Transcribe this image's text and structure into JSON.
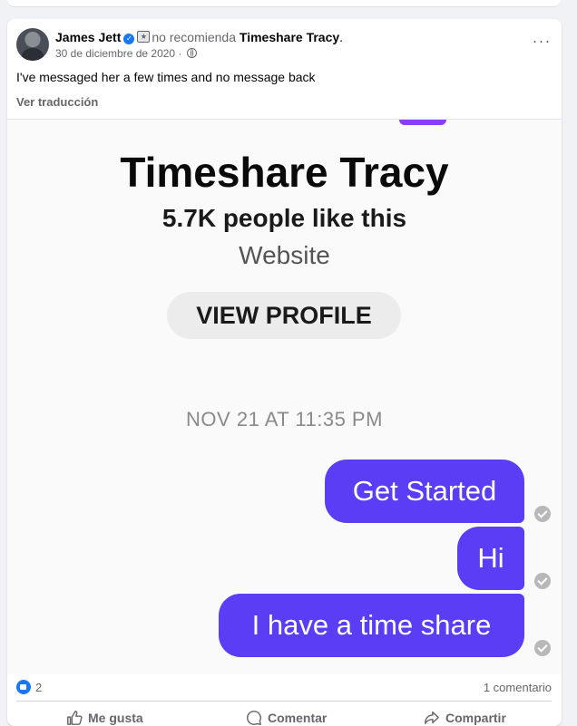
{
  "post": {
    "author": "James Jett",
    "recommend_text": "no recomienda",
    "page_name": "Timeshare Tracy",
    "page_suffix": ".",
    "date": "30 de diciembre de 2020 ·",
    "text": "I've messaged her a few times and no message back",
    "translate_label": "Ver traducción",
    "more_label": "···"
  },
  "screenshot": {
    "page_title": "Timeshare Tracy",
    "likes": "5.7K people like this",
    "category": "Website",
    "view_profile": "VIEW PROFILE",
    "timestamp": "NOV 21 AT 11:35 PM",
    "messages": [
      "Get Started",
      "Hi",
      "I have a time share"
    ]
  },
  "footer": {
    "reaction_count": "2",
    "comments": "1 comentario",
    "like_label": "Me gusta",
    "comment_label": "Comentar",
    "share_label": "Compartir"
  },
  "colors": {
    "bubble": "#5b3df5",
    "facebook_blue": "#1877f2"
  },
  "icons": [
    "verified-icon",
    "not-recommend-icon",
    "globe-icon",
    "more-icon",
    "like-icon",
    "comment-icon",
    "share-icon"
  ]
}
